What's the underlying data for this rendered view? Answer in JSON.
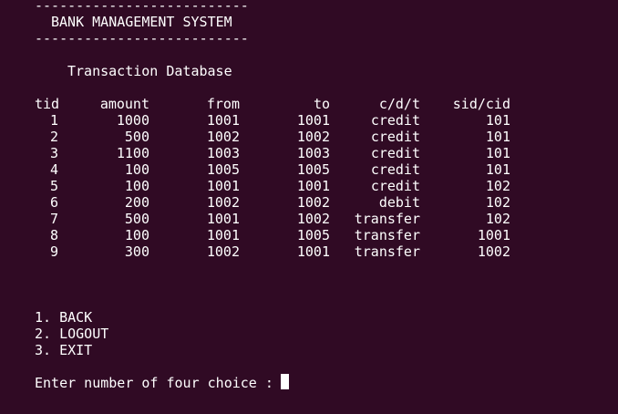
{
  "banner": {
    "rule_top": "--------------------------",
    "title": "BANK MANAGEMENT SYSTEM",
    "rule_bottom": "--------------------------"
  },
  "subtitle": "Transaction Database",
  "table": {
    "headers": {
      "tid": "tid",
      "amount": "amount",
      "from": "from",
      "to": "to",
      "type": "c/d/t",
      "sid": "sid/cid"
    },
    "rows": [
      {
        "tid": "1",
        "amount": "1000",
        "from": "1001",
        "to": "1001",
        "type": "credit",
        "sid": "101"
      },
      {
        "tid": "2",
        "amount": "500",
        "from": "1002",
        "to": "1002",
        "type": "credit",
        "sid": "101"
      },
      {
        "tid": "3",
        "amount": "1100",
        "from": "1003",
        "to": "1003",
        "type": "credit",
        "sid": "101"
      },
      {
        "tid": "4",
        "amount": "100",
        "from": "1005",
        "to": "1005",
        "type": "credit",
        "sid": "101"
      },
      {
        "tid": "5",
        "amount": "100",
        "from": "1001",
        "to": "1001",
        "type": "credit",
        "sid": "102"
      },
      {
        "tid": "6",
        "amount": "200",
        "from": "1002",
        "to": "1002",
        "type": "debit",
        "sid": "102"
      },
      {
        "tid": "7",
        "amount": "500",
        "from": "1001",
        "to": "1002",
        "type": "transfer",
        "sid": "102"
      },
      {
        "tid": "8",
        "amount": "100",
        "from": "1001",
        "to": "1005",
        "type": "transfer",
        "sid": "1001"
      },
      {
        "tid": "9",
        "amount": "300",
        "from": "1002",
        "to": "1001",
        "type": "transfer",
        "sid": "1002"
      }
    ]
  },
  "menu": {
    "items": [
      "1. BACK",
      "2. LOGOUT",
      "3. EXIT"
    ]
  },
  "prompt": "Enter number of four choice : ",
  "colors": {
    "background": "#300a24",
    "text": "#ffffff"
  }
}
